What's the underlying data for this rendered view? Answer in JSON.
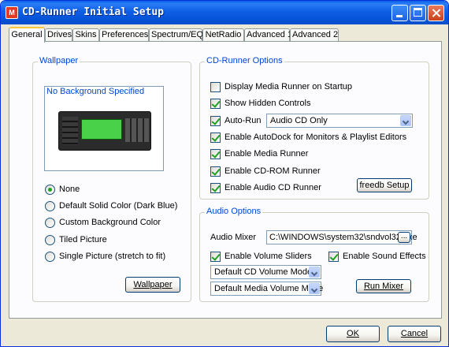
{
  "window": {
    "title": "CD-Runner Initial Setup"
  },
  "tabs": [
    {
      "label": "General"
    },
    {
      "label": "Drives"
    },
    {
      "label": "Skins"
    },
    {
      "label": "Preferences"
    },
    {
      "label": "Spectrum/EQ"
    },
    {
      "label": "NetRadio"
    },
    {
      "label": "Advanced 1"
    },
    {
      "label": "Advanced 2"
    }
  ],
  "wallpaper": {
    "title": "Wallpaper",
    "preview_text": "No Background Specified",
    "options": [
      {
        "label": "None",
        "selected": true
      },
      {
        "label": "Default Solid Color (Dark Blue)",
        "selected": false
      },
      {
        "label": "Custom Background Color",
        "selected": false
      },
      {
        "label": "Tiled Picture",
        "selected": false
      },
      {
        "label": "Single Picture (stretch to fit)",
        "selected": false
      }
    ],
    "button_label": "Wallpaper"
  },
  "options": {
    "title": "CD-Runner Options",
    "display_startup": {
      "label": "Display Media Runner on Startup",
      "checked": false
    },
    "show_hidden": {
      "label": "Show Hidden Controls",
      "checked": true
    },
    "auto_run": {
      "label": "Auto-Run",
      "checked": true,
      "value": "Audio CD Only"
    },
    "autodock": {
      "label": "Enable AutoDock for Monitors & Playlist Editors",
      "checked": true
    },
    "media_runner": {
      "label": "Enable Media Runner",
      "checked": true
    },
    "cdrom_runner": {
      "label": "Enable CD-ROM Runner",
      "checked": true
    },
    "audio_cd_runner": {
      "label": "Enable Audio CD Runner",
      "checked": true
    },
    "freedb_label": "freedb Setup"
  },
  "audio": {
    "title": "Audio Options",
    "mixer_label": "Audio Mixer",
    "mixer_path": "C:\\WINDOWS\\system32\\sndvol32.exe",
    "browse_label": "...",
    "volume_sliders": {
      "label": "Enable Volume Sliders",
      "checked": true
    },
    "sound_effects": {
      "label": "Enable Sound Effects",
      "checked": true
    },
    "cd_volume_mode": "Default CD Volume Mode",
    "media_volume_mode": "Default Media Volume Mode",
    "run_mixer_label": "Run Mixer"
  },
  "footer": {
    "ok_label": "OK",
    "cancel_label": "Cancel"
  }
}
